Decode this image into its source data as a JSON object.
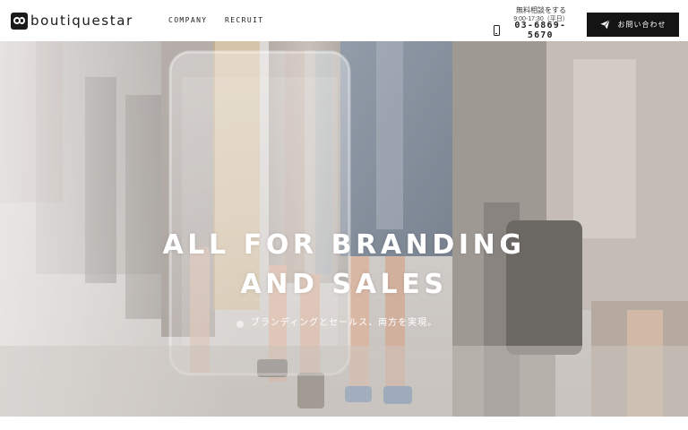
{
  "header": {
    "logo_text": "boutiquestar",
    "nav": [
      {
        "label": "COMPANY"
      },
      {
        "label": "RECRUIT"
      }
    ],
    "contact": {
      "label": "無料相談をする",
      "hours": "9:00-17:30（平日）",
      "phone": "03-6869-5670"
    },
    "cta": {
      "label": "お問い合わせ",
      "icon": "paper-plane-icon"
    }
  },
  "hero": {
    "title_line1": "ALL FOR BRANDING",
    "title_line2": "AND SALES",
    "subtitle": "ブランディングとセールス、両方を実現。"
  },
  "colors": {
    "header_bg": "#ffffff",
    "cta_bg": "#141414",
    "hero_text": "#ffffff"
  }
}
